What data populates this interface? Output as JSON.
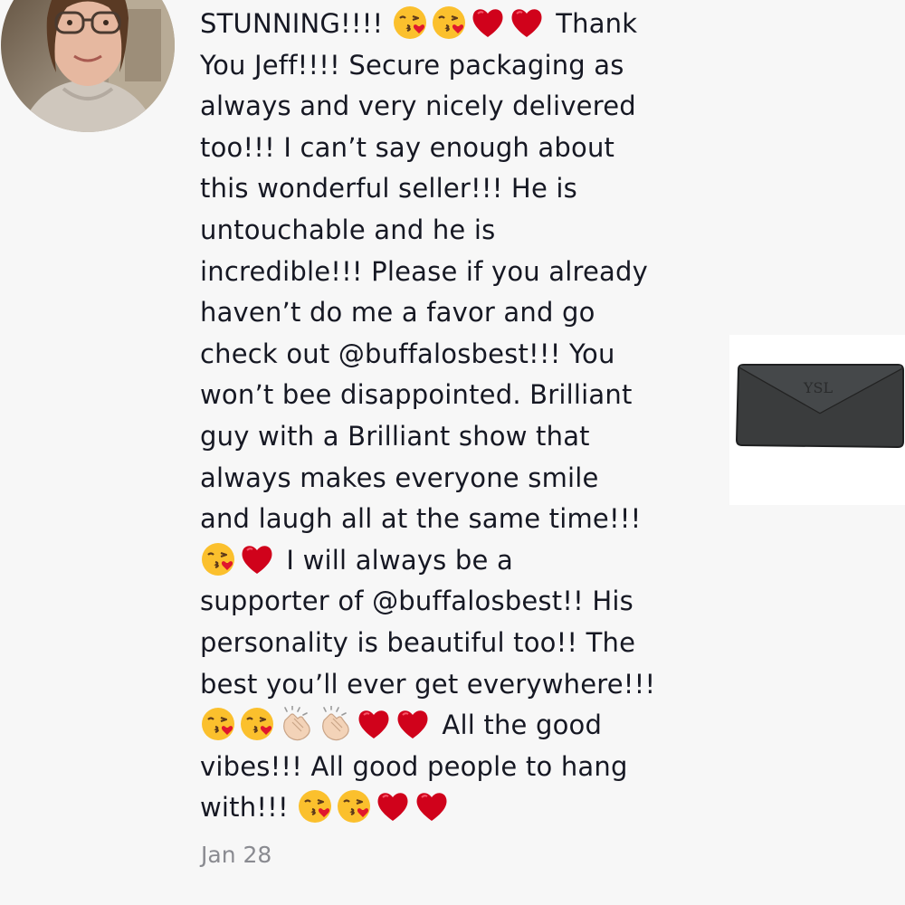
{
  "comment": {
    "avatar_icon": "user-avatar-photo",
    "lines": [
      {
        "before": [
          "kiss-emoji",
          "kiss-emoji",
          "heart-emoji",
          "heart-emoji"
        ],
        "pre_text": "STUNNING!!!! ",
        "text": " Thank"
      },
      {
        "text": "You Jeff!!!! Secure packaging as"
      },
      {
        "text": "always and very nicely delivered"
      },
      {
        "text": "too!!! I can’t say enough about"
      },
      {
        "text": "this wonderful seller!!! He is"
      },
      {
        "text": "untouchable and he is"
      },
      {
        "text": "incredible!!! Please if you already"
      },
      {
        "text": "haven’t do me a favor and go"
      },
      {
        "text": "check out @buffalosbest!!! You"
      },
      {
        "text": "won’t bee disappointed. Brilliant"
      },
      {
        "text": "guy with a Brilliant show that"
      },
      {
        "text": "always makes everyone smile"
      },
      {
        "text": "and laugh all at the same time!!!"
      },
      {
        "emojis": [
          "kiss-emoji",
          "heart-emoji"
        ],
        "text": " I will always be a"
      },
      {
        "text": "supporter of @buffalosbest!! His"
      },
      {
        "text": "personality is beautiful too!! The"
      },
      {
        "text": "best you’ll ever get everywhere!!!"
      },
      {
        "emojis": [
          "kiss-emoji",
          "kiss-emoji",
          "clap-emoji",
          "clap-emoji",
          "heart-emoji",
          "heart-emoji"
        ],
        "text": " All the good"
      },
      {
        "text": "vibes!!! All good people to hang"
      },
      {
        "pre_text": "with!!! ",
        "emojis_after": [
          "kiss-emoji",
          "kiss-emoji",
          "heart-emoji",
          "heart-emoji"
        ],
        "text": ""
      }
    ],
    "date": "Jan 28"
  },
  "product": {
    "icon": "wallet-thumbnail"
  },
  "colors": {
    "text": "#161823",
    "date": "#8a8b91",
    "background": "#f7f7f7",
    "heart": "#d0021b",
    "kiss_face": "#fbc02d"
  }
}
